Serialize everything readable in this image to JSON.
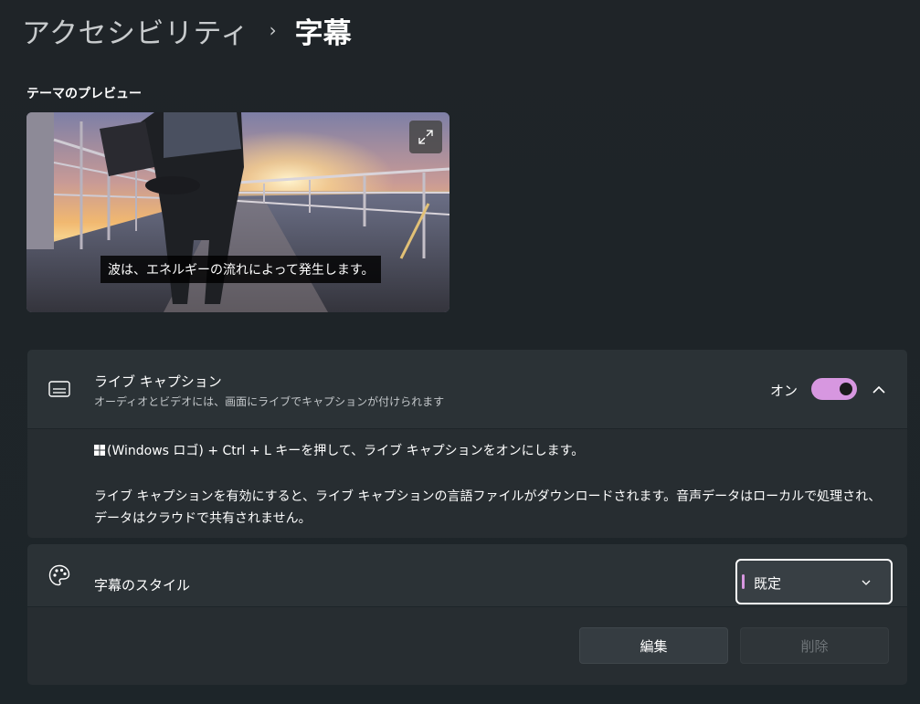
{
  "breadcrumb": {
    "parent": "アクセシビリティ",
    "separator": "›",
    "current": "字幕"
  },
  "preview": {
    "title": "テーマのプレビュー",
    "caption": "波は、エネルギーの流れによって発生します。",
    "expand_icon": "expand-icon"
  },
  "live_captions": {
    "icon": "captions-icon",
    "title": "ライブ キャプション",
    "subtitle": "オーディオとビデオには、画面にライブでキャプションが付けられます",
    "toggle_label": "オン",
    "toggle_on": true,
    "shortcut_text": "(Windows ロゴ) + Ctrl + L キーを押して、ライブ キャプションをオンにします。",
    "info_line1": "ライブ キャプションを有効にすると、ライブ キャプションの言語ファイルがダウンロードされます。音声データはローカルで処理され、",
    "info_line2": "データはクラウドで共有されません。"
  },
  "caption_style": {
    "icon": "palette-icon",
    "title": "字幕のスタイル",
    "selected": "既定",
    "edit_label": "編集",
    "delete_label": "削除"
  },
  "colors": {
    "accent": "#d797e0",
    "background": "#1f2529",
    "card": "#2b3236"
  }
}
